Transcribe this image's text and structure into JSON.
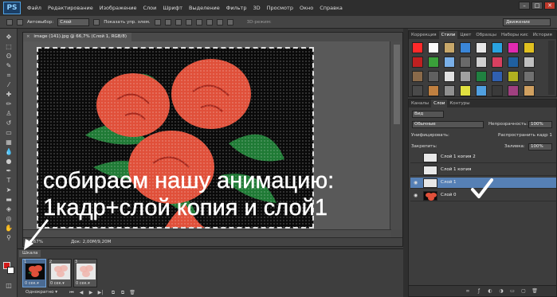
{
  "app": {
    "logo": "PS"
  },
  "menu": [
    "Файл",
    "Редактирование",
    "Изображение",
    "Слои",
    "Шрифт",
    "Выделение",
    "Фильтр",
    "3D",
    "Просмотр",
    "Окно",
    "Справка"
  ],
  "window_buttons": [
    "–",
    "□",
    "✕"
  ],
  "options_bar": {
    "autoselect_label": "Автовыбор:",
    "autoselect_value": "Слой",
    "show_controls_label": "Показать упр. элем.",
    "mode_3d_label": "3D-режим:",
    "workspace_value": "Движение"
  },
  "document": {
    "tab_title": "image (141).jpg @ 66,7% (Слой 1, RGB/8)",
    "close_glyph": "×",
    "zoom": "66,67%",
    "doc_size": "Док: 2,00M/9,20M"
  },
  "caption": {
    "line1": "собираем нашу анимацию:",
    "line2": "1кадр+слой копия и слой1"
  },
  "timeline": {
    "tab_label": "Шкала",
    "frames": [
      {
        "num": "1",
        "time": "0 сек.▾"
      },
      {
        "num": "2",
        "time": "0 сек.▾"
      },
      {
        "num": "3",
        "time": "0 сек.▾"
      }
    ],
    "loop_value": "Однократно ▾",
    "controls": [
      "⏮",
      "◀",
      "▶",
      "▶|",
      "⧉",
      "⧉",
      "🗑"
    ]
  },
  "styles_panel": {
    "tabs": [
      "Коррекция",
      "Стили",
      "Цвет",
      "Образцы",
      "Наборы кис",
      "История"
    ],
    "active_tab": "Стили",
    "swatch_colors": [
      "#ff2a2a",
      "#fafafa",
      "#c8a86a",
      "#3a86d8",
      "#e8e8e8",
      "#2aa3e0",
      "#e02ab0",
      "#e0c020",
      "#c02020",
      "#3aa03a",
      "#7ab0e8",
      "#6a6a6a",
      "#d0d0d0",
      "#d84060",
      "#2060a0",
      "#c0c0c0",
      "#8a6a4a",
      "#606060",
      "#e0e0e0",
      "#a0a0a0",
      "#208040",
      "#3060b0",
      "#b0b020",
      "#707070",
      "#4a4a4a",
      "#c08040",
      "#909090",
      "#e0e040",
      "#50a0e0",
      "#3a3a3a",
      "#a04080",
      "#d0a060"
    ]
  },
  "layers_panel": {
    "tabs": [
      "Каналы",
      "Слои",
      "Контуры"
    ],
    "active_tab": "Слои",
    "filter_label": "Вид",
    "blend_mode": "Обычные",
    "opacity_label": "Непрозрачность:",
    "opacity_value": "100%",
    "unify_label": "Унифицировать:",
    "propagate_label": "Распространить кадр 1",
    "lock_label": "Закрепить:",
    "fill_label": "Заливка:",
    "fill_value": "100%",
    "layers": [
      {
        "name": "Слой 1 копия 2",
        "selected": false,
        "thumb": "transparent"
      },
      {
        "name": "Слой 1 копия",
        "selected": false,
        "thumb": "transparent"
      },
      {
        "name": "Слой 1",
        "selected": true,
        "thumb": "transparent"
      },
      {
        "name": "Слой 0",
        "selected": false,
        "thumb": "roses"
      }
    ],
    "footer_icons": [
      "link-icon",
      "fx-icon",
      "mask-icon",
      "adjustment-icon",
      "folder-icon",
      "new-layer-icon",
      "trash-icon"
    ]
  },
  "colors": {
    "foreground": "#d11a1a",
    "background": "#ffffff",
    "selection": "#5680b5"
  }
}
